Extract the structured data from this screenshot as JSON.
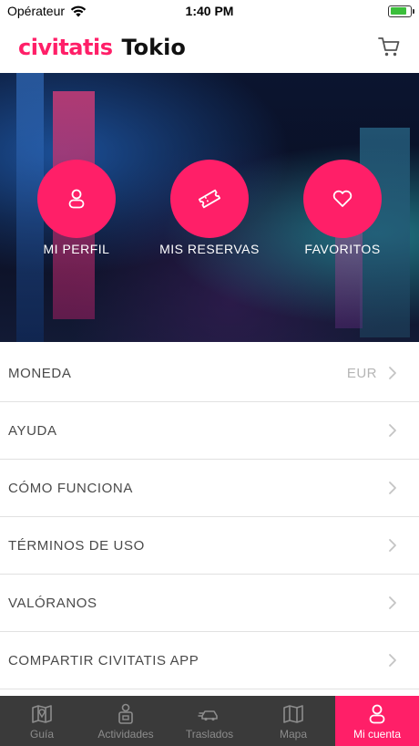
{
  "status_bar": {
    "carrier": "Opérateur",
    "time": "1:40 PM",
    "battery_level": 0.85
  },
  "header": {
    "brand": "civitatis",
    "city": "Tokio"
  },
  "hero": {
    "actions": [
      {
        "label": "MI PERFIL",
        "icon": "person-icon"
      },
      {
        "label": "MIS RESERVAS",
        "icon": "ticket-icon"
      },
      {
        "label": "FAVORITOS",
        "icon": "heart-icon"
      }
    ]
  },
  "menu": [
    {
      "label": "MONEDA",
      "value": "EUR"
    },
    {
      "label": "AYUDA"
    },
    {
      "label": "CÓMO FUNCIONA"
    },
    {
      "label": "TÉRMINOS DE USO"
    },
    {
      "label": "VALÓRANOS"
    },
    {
      "label": "COMPARTIR CIVITATIS APP"
    }
  ],
  "tabbar": {
    "tabs": [
      {
        "label": "Guía",
        "icon": "map-guide-icon"
      },
      {
        "label": "Actividades",
        "icon": "activities-icon"
      },
      {
        "label": "Traslados",
        "icon": "transfer-icon"
      },
      {
        "label": "Mapa",
        "icon": "map-icon"
      },
      {
        "label": "Mi cuenta",
        "icon": "account-icon"
      }
    ],
    "active": "Mi cuenta"
  },
  "colors": {
    "accent": "#ff1f68",
    "tabbar_bg": "#3a3a3a",
    "divider": "#e1e1e1"
  }
}
